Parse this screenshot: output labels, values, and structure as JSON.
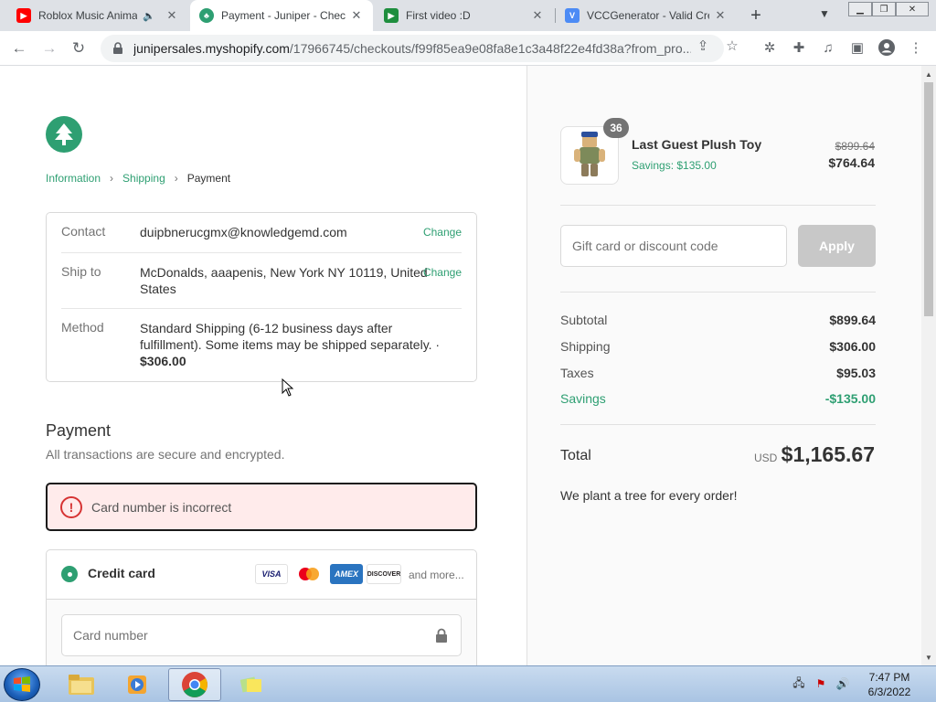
{
  "browser": {
    "tabs": [
      {
        "title": "Roblox Music Animat",
        "favicon_color": "#ff0000"
      },
      {
        "title": "Payment - Juniper - Chec",
        "favicon_color": "#2e9f72"
      },
      {
        "title": "First video :D",
        "favicon_color": "#1e8e3e"
      },
      {
        "title": "VCCGenerator - Valid Cre",
        "favicon_color": "#4c8bf5"
      }
    ],
    "url_host": "junipersales.myshopify.com",
    "url_path": "/17966745/checkouts/f99f85ea9e08fa8e1c3a48f22e4fd38a?from_pro..."
  },
  "breadcrumbs": {
    "information": "Information",
    "shipping": "Shipping",
    "payment": "Payment"
  },
  "review": {
    "contact_label": "Contact",
    "contact_value": "duipbnerucgmx@knowledgemd.com",
    "ship_label": "Ship to",
    "ship_value": "McDonalds, aaapenis, New York NY 10119, United States",
    "method_label": "Method",
    "method_value": "Standard Shipping (6-12 business days after fulfillment). Some items may be shipped separately. ·",
    "method_price": "$306.00",
    "change_label": "Change"
  },
  "payment": {
    "title": "Payment",
    "subtitle": "All transactions are secure and encrypted.",
    "error": "Card number is incorrect",
    "method_label": "Credit card",
    "card_brands": [
      "VISA",
      "mastercard",
      "AMEX",
      "DISCOVER"
    ],
    "more": "and more...",
    "card_number_placeholder": "Card number"
  },
  "summary": {
    "product": {
      "quantity": "36",
      "name": "Last Guest Plush Toy",
      "savings": "Savings: $135.00",
      "original_price": "$899.64",
      "price": "$764.64"
    },
    "discount_placeholder": "Gift card or discount code",
    "apply_label": "Apply",
    "subtotal_label": "Subtotal",
    "subtotal": "$899.64",
    "shipping_label": "Shipping",
    "shipping": "$306.00",
    "taxes_label": "Taxes",
    "taxes": "$95.03",
    "savings_label": "Savings",
    "savings": "-$135.00",
    "total_label": "Total",
    "currency": "USD",
    "total": "$1,165.67",
    "note": "We plant a tree for every order!"
  },
  "taskbar": {
    "time": "7:47 PM",
    "date": "6/3/2022"
  },
  "colors": {
    "accent": "#2e9f72",
    "error_border": "#1a1a1a",
    "error_bg": "#ffebeb"
  }
}
